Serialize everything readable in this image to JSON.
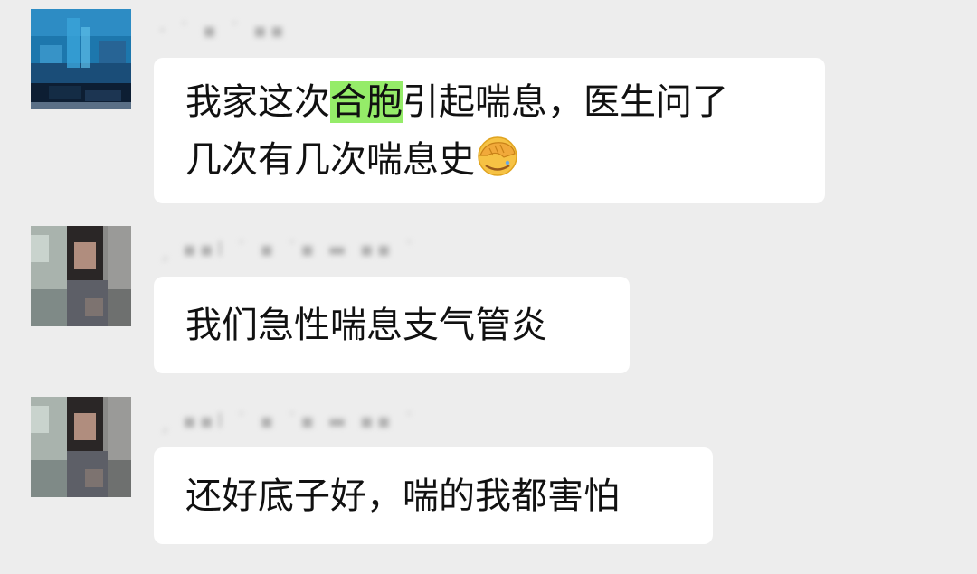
{
  "messages": [
    {
      "sender": "· ˙ ▪ ˙ ▪▪",
      "text_before": "我家这次",
      "highlight": "合胞",
      "text_after": "引起喘息，医生问了",
      "line2": "几次有几次喘息史",
      "emoji": "facepalm-emoji"
    },
    {
      "sender": "ˏ ▪▪Ⅰ ˙ ▪   ˙▪ ▬ ▪▪ ˙",
      "text": "我们急性喘息支气管炎"
    },
    {
      "sender": "ˏ ▪▪Ⅰ ˙ ▪   ˙▪ ▬ ▪▪ ˙",
      "text": "还好底子好，喘的我都害怕"
    }
  ],
  "colors": {
    "background": "#ededed",
    "bubble": "#ffffff",
    "highlight": "#95ec69"
  }
}
